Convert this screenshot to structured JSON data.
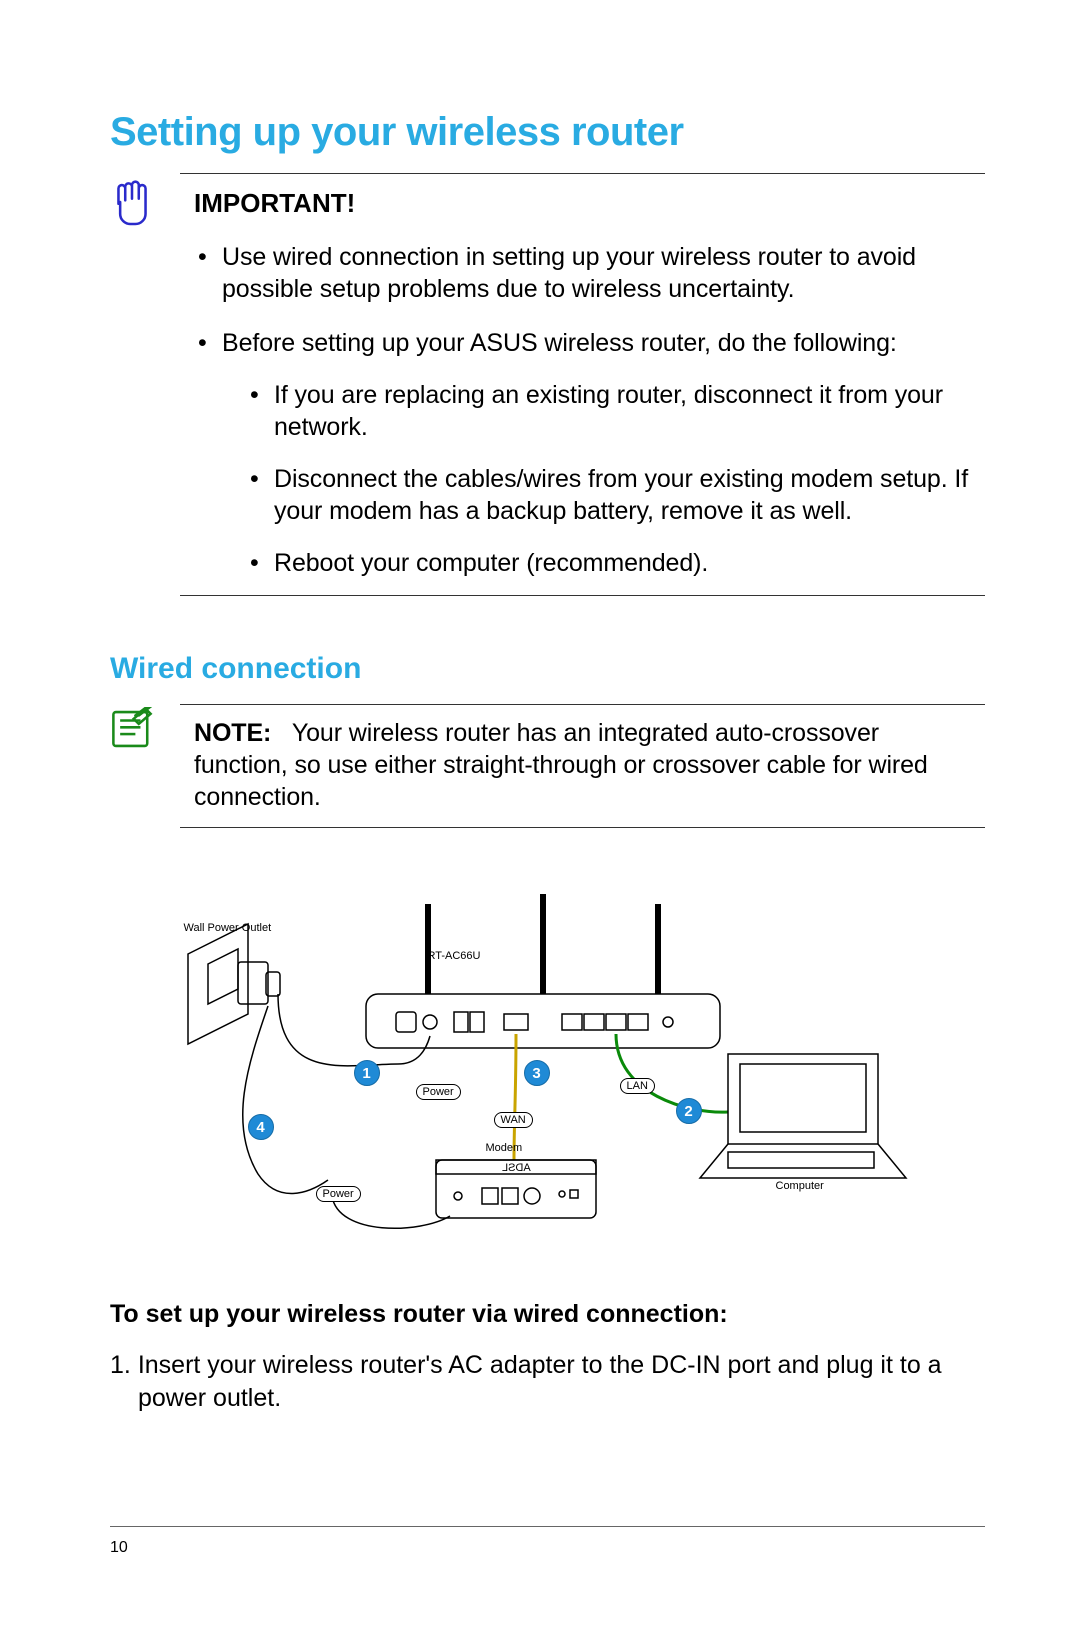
{
  "title": "Setting up your wireless router",
  "important": {
    "label": "IMPORTANT!",
    "bullets": {
      "b1": "Use wired connection in setting up your wireless router to avoid possible setup problems due to wireless uncertainty.",
      "b2": "Before setting up your ASUS wireless router, do the following:",
      "sub": {
        "s1": "If you are replacing an existing router, disconnect it from your network.",
        "s2": "Disconnect the cables/wires from your existing modem setup. If your modem has a backup battery, remove it as well.",
        "s3": "Reboot your computer (recommended)."
      }
    }
  },
  "wired": {
    "heading": "Wired connection",
    "note_label": "NOTE:",
    "note_body": "Your wireless router has an integrated auto-crossover function, so use either straight-through or crossover cable for wired connection."
  },
  "diagram": {
    "wall": "Wall Power Outlet",
    "router": "RT-AC66U",
    "modem": "Modem",
    "modem_brand": "ADSL",
    "computer": "Computer",
    "power1": "Power",
    "power2": "Power",
    "wan": "WAN",
    "lan": "LAN",
    "markers": {
      "m1": "1",
      "m2": "2",
      "m3": "3",
      "m4": "4"
    }
  },
  "instructions": {
    "heading": "To set up your wireless router via wired connection:",
    "step1_num": "1.",
    "step1": "Insert your wireless router's AC adapter to the DC-IN port and plug it to a power outlet."
  },
  "page_number": "10"
}
